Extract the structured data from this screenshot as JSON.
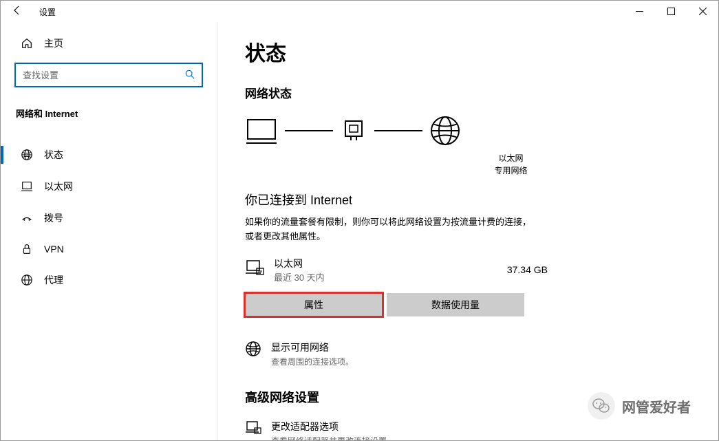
{
  "titlebar": {
    "title": "设置"
  },
  "sidebar": {
    "home": "主页",
    "search_placeholder": "查找设置",
    "category": "网络和 Internet",
    "items": [
      {
        "label": "状态"
      },
      {
        "label": "以太网"
      },
      {
        "label": "拨号"
      },
      {
        "label": "VPN"
      },
      {
        "label": "代理"
      }
    ]
  },
  "main": {
    "heading": "状态",
    "subheading": "网络状态",
    "diagram": {
      "ethernet_label": "以太网",
      "network_type": "专用网络"
    },
    "connected_title": "你已连接到 Internet",
    "connected_desc": "如果你的流量套餐有限制，则你可以将此网络设置为按流量计费的连接，或者更改其他属性。",
    "connection": {
      "name": "以太网",
      "period": "最近 30 天内",
      "usage": "37.34 GB"
    },
    "buttons": {
      "properties": "属性",
      "data_usage": "数据使用量"
    },
    "available_networks": {
      "title": "显示可用网络",
      "sub": "查看周围的连接选项。"
    },
    "advanced_heading": "高级网络设置",
    "adapter": {
      "title": "更改适配器选项",
      "sub": "查看网络适配器并更改连接设置。"
    }
  },
  "watermark": {
    "text": "网管爱好者"
  }
}
